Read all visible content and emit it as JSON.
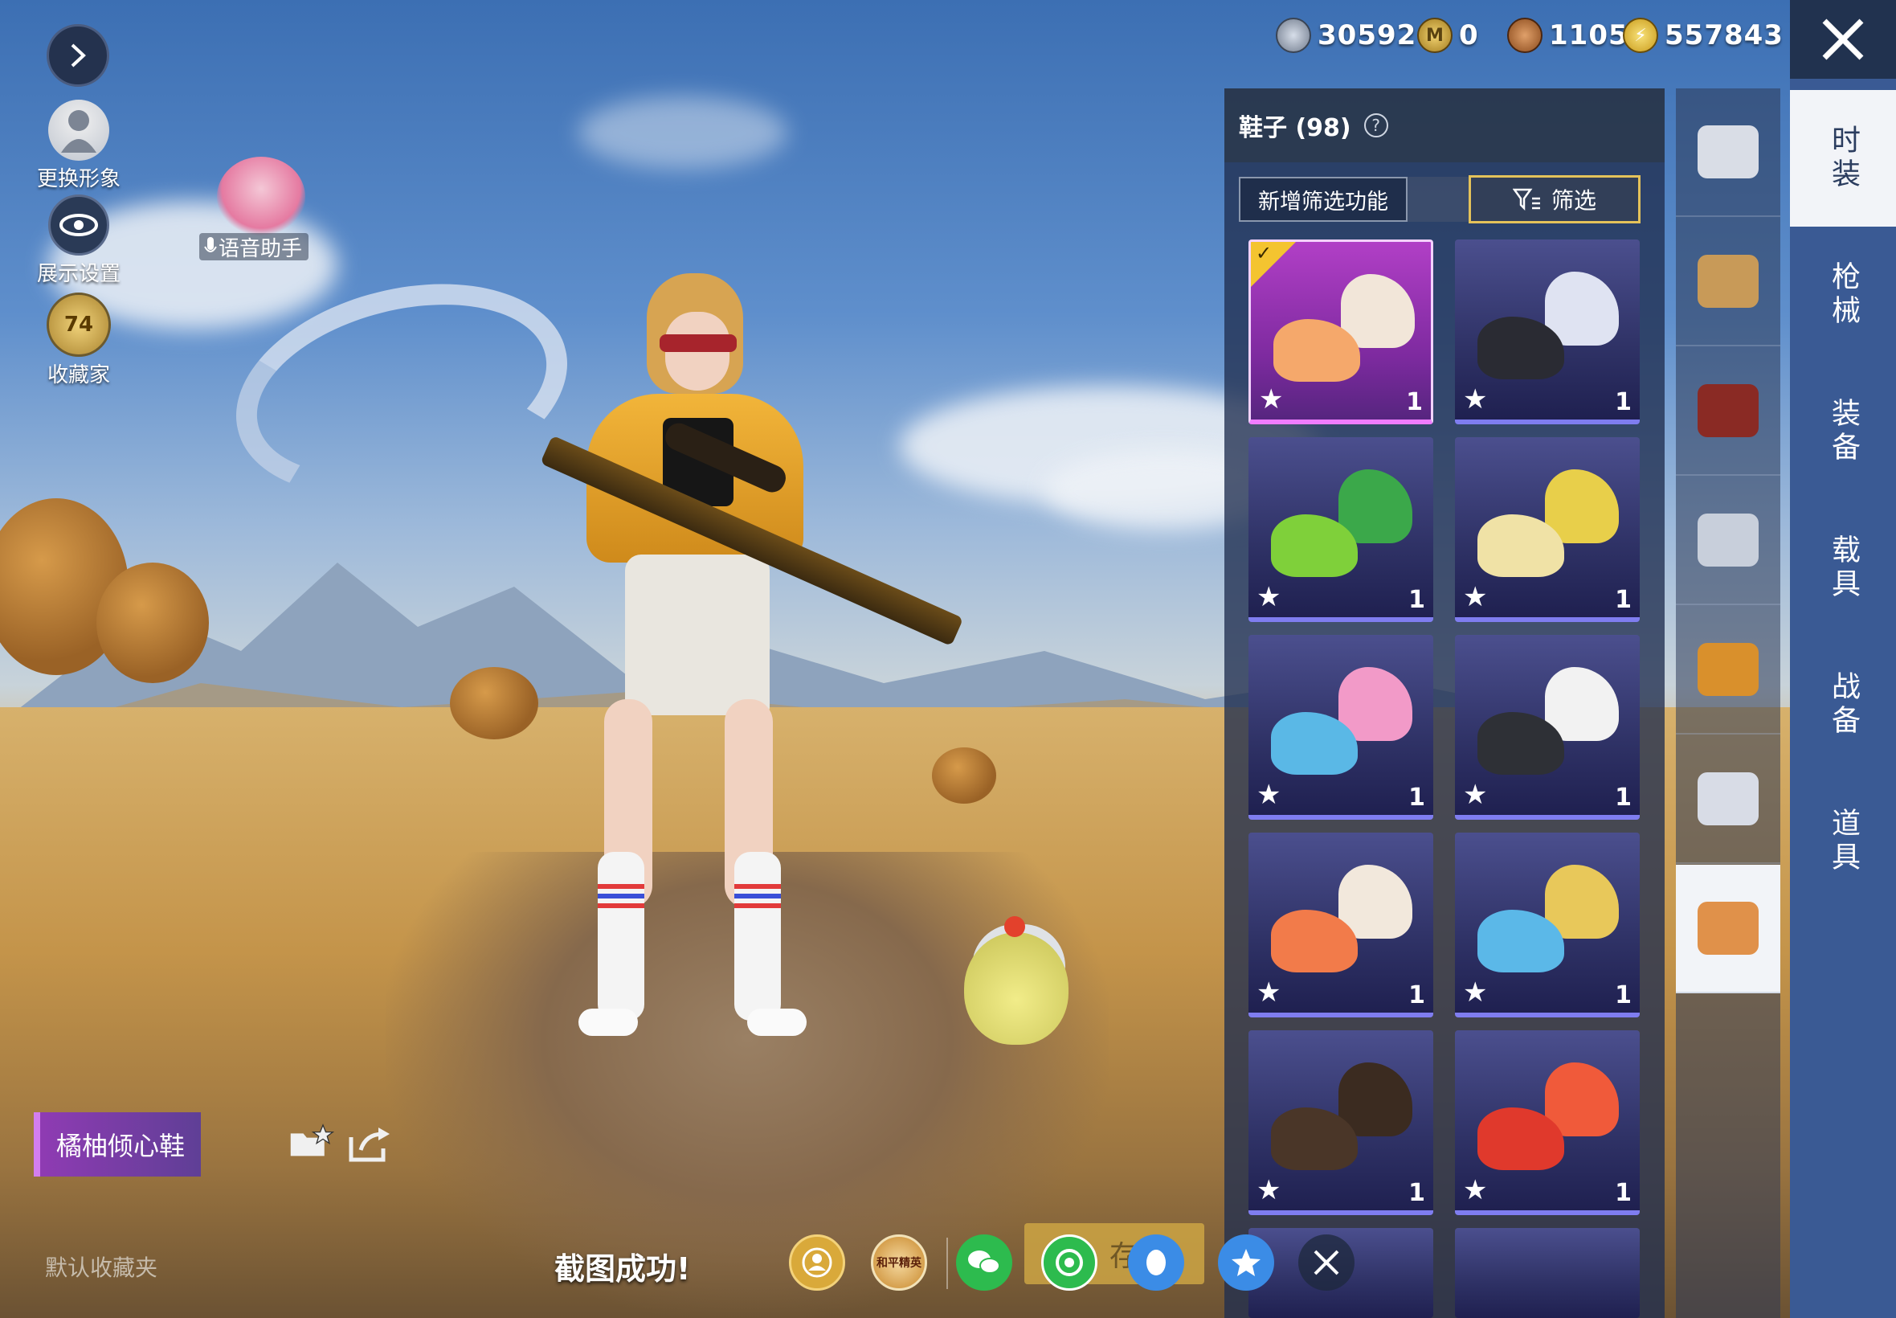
{
  "left_menu": {
    "change_avatar": "更换形象",
    "display_settings": "展示设置",
    "collector": "收藏家",
    "collector_level": "74",
    "voice_assistant": "语音助手"
  },
  "currency": [
    {
      "icon": "silver-coin-icon",
      "value": "30592",
      "color": "#9aa6b8"
    },
    {
      "icon": "gold-token-icon",
      "value": "0",
      "color": "#c9a23a"
    },
    {
      "icon": "bronze-coin-icon",
      "value": "1105",
      "color": "#a8612c"
    },
    {
      "icon": "lightning-coin-icon",
      "value": "557843",
      "color": "#e9c33a"
    }
  ],
  "panel": {
    "title": "鞋子 (98)",
    "new_filter": "新增筛选功能",
    "filter": "筛选"
  },
  "items": [
    {
      "qty": "1",
      "selected": true,
      "color_a": "#f5a86b",
      "color_b": "#f2e6d9"
    },
    {
      "qty": "1",
      "selected": false,
      "color_a": "#2a2b33",
      "color_b": "#dfe3f2"
    },
    {
      "qty": "1",
      "selected": false,
      "color_a": "#7fd03a",
      "color_b": "#3ba84a"
    },
    {
      "qty": "1",
      "selected": false,
      "color_a": "#f0e2a6",
      "color_b": "#e8cf4a"
    },
    {
      "qty": "1",
      "selected": false,
      "color_a": "#5ab8e6",
      "color_b": "#f29ac8"
    },
    {
      "qty": "1",
      "selected": false,
      "color_a": "#2e3036",
      "color_b": "#f2f2f2"
    },
    {
      "qty": "1",
      "selected": false,
      "color_a": "#f27b4a",
      "color_b": "#f2e8dc"
    },
    {
      "qty": "1",
      "selected": false,
      "color_a": "#5bb8e8",
      "color_b": "#e8c85a"
    },
    {
      "qty": "1",
      "selected": false,
      "color_a": "#4a3628",
      "color_b": "#3b2b20"
    },
    {
      "qty": "1",
      "selected": false,
      "color_a": "#e0392c",
      "color_b": "#f05a3a"
    }
  ],
  "categories": [
    {
      "name": "outfit-icon",
      "color": "#d9dde6"
    },
    {
      "name": "headgear-icon",
      "color": "#c89a58"
    },
    {
      "name": "hat-icon",
      "color": "#8a2a24"
    },
    {
      "name": "mask-icon",
      "color": "#c8cfdb"
    },
    {
      "name": "jacket-icon",
      "color": "#d9902c"
    },
    {
      "name": "pants-icon",
      "color": "#d8dce6"
    },
    {
      "name": "shoes-icon",
      "color": "#e0914a"
    }
  ],
  "tabs": [
    {
      "label": "时装",
      "active": true
    },
    {
      "label": "枪械",
      "active": false
    },
    {
      "label": "装备",
      "active": false
    },
    {
      "label": "载具",
      "active": false
    },
    {
      "label": "战备",
      "active": false
    },
    {
      "label": "道具",
      "active": false
    }
  ],
  "selected_item_name": "橘柚倾心鞋",
  "default_favorites": "默认收藏夹",
  "screenshot_toast": "截图成功!",
  "share": {
    "game_logo": "和平精英",
    "save_label": "存搭"
  }
}
